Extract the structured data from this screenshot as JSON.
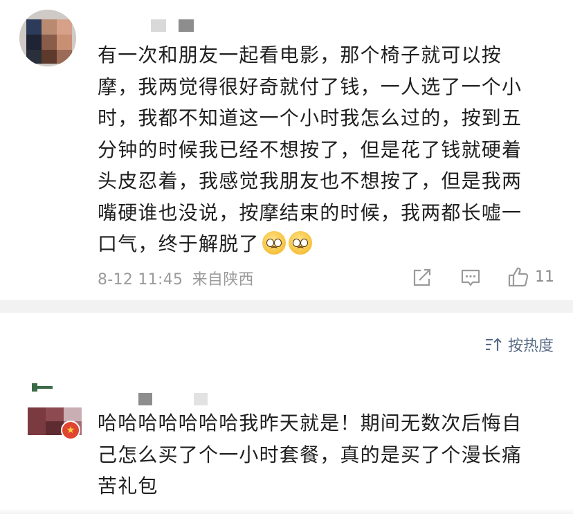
{
  "comment1": {
    "lines": [
      "有一次和朋友一起看电影，那个椅子就可以按",
      "摩，我两觉得很好奇就付了钱，一人选了一个小",
      "时，我都不知道这一个小时我怎么过的，按到五",
      "分钟的时候我已经不想按了，但是花了钱就硬着",
      "头皮忍着，我感觉我朋友也不想按了，但是我两",
      "嘴硬谁也没说，按摩结束的时候，我两都长嘘一",
      "口气，终于解脱了"
    ],
    "timestamp": "8-12 11:45",
    "location": "来自陕西",
    "like_count": "11",
    "icons": [
      "share-icon",
      "comment-icon",
      "thumbs-up-icon",
      "pleading-face-emoji"
    ]
  },
  "sort": {
    "label": "按热度",
    "icon": "sort-icon"
  },
  "comment2": {
    "lines": [
      "哈哈哈哈哈哈哈我昨天就是！期间无数次后悔自",
      "己怎么买了个一小时套餐，真的是买了个漫长痛",
      "苦礼包"
    ],
    "badge_icon": "verified-badge-icon"
  },
  "colors": {
    "text": "#1f1f1f",
    "meta": "#9a9a9a",
    "sort_accent": "#5a6c86",
    "divider": "#f2f2f2",
    "emoji": "#f6c03b"
  }
}
